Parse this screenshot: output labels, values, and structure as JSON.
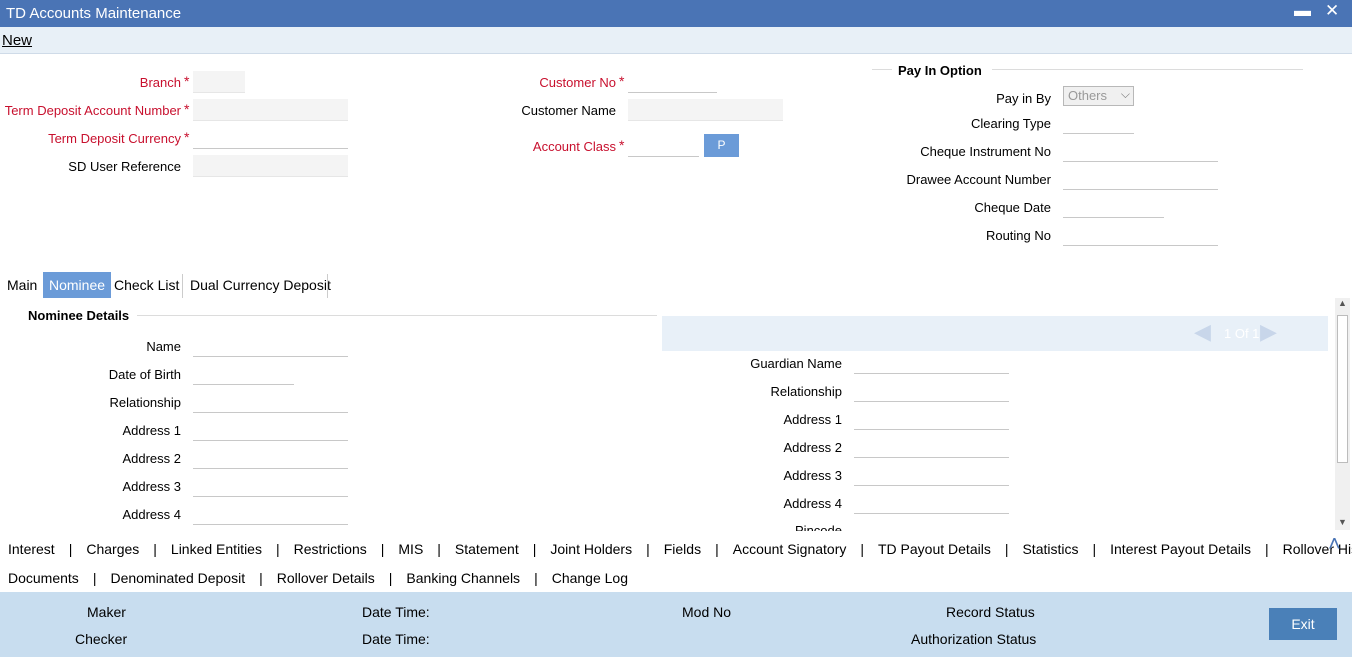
{
  "window": {
    "title": "TD Accounts Maintenance",
    "minimize": "▬",
    "close": "✕"
  },
  "menu": {
    "new": "New"
  },
  "header_left": {
    "branch": "Branch",
    "td_account_number": "Term Deposit Account Number",
    "td_currency": "Term Deposit Currency",
    "sd_user_reference": "SD User Reference",
    "required_mark": "*"
  },
  "header_mid": {
    "customer_no": "Customer No",
    "customer_name": "Customer Name",
    "account_class": "Account Class",
    "p_button": "P"
  },
  "pay_in": {
    "title": "Pay In Option",
    "pay_in_by": "Pay in By",
    "pay_in_by_value": "Others",
    "clearing_type": "Clearing Type",
    "cheque_instrument_no": "Cheque Instrument No",
    "drawee_account_number": "Drawee Account Number",
    "cheque_date": "Cheque Date",
    "routing_no": "Routing No"
  },
  "tabs": [
    "Main",
    "Nominee",
    "Check List",
    "Dual Currency Deposit"
  ],
  "nominee": {
    "title": "Nominee Details",
    "left": [
      "Name",
      "Date of Birth",
      "Relationship",
      "Address 1",
      "Address 2",
      "Address 3",
      "Address 4"
    ],
    "right": [
      "Guardian Name",
      "Relationship",
      "Address 1",
      "Address 2",
      "Address 3",
      "Address 4",
      "Pincode"
    ],
    "pager": "1 Of 1"
  },
  "links_row1": [
    "Interest",
    "Charges",
    "Linked Entities",
    "Restrictions",
    "MIS",
    "Statement",
    "Joint Holders",
    "Fields",
    "Account Signatory",
    "TD Payout Details",
    "Statistics",
    "Interest Payout Details",
    "Rollover History"
  ],
  "links_row2": [
    "Documents",
    "Denominated Deposit",
    "Rollover Details",
    "Banking Channels",
    "Change Log"
  ],
  "footer": {
    "maker": "Maker",
    "checker": "Checker",
    "date_time": "Date Time:",
    "mod_no": "Mod No",
    "record_status": "Record Status",
    "authorization_status": "Authorization Status",
    "exit": "Exit"
  }
}
